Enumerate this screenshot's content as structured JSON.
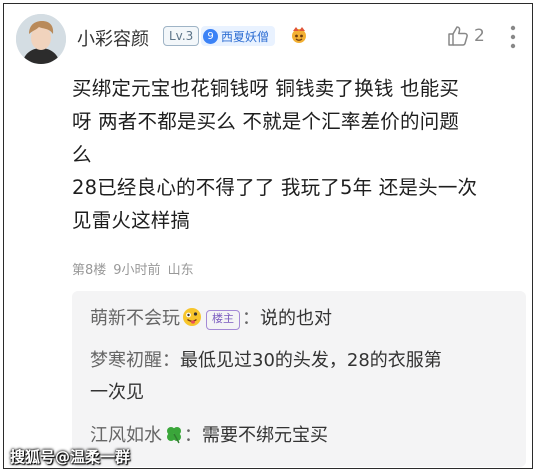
{
  "comment": {
    "username": "小彩容颜",
    "level": "Lv.3",
    "badge_number": "9",
    "badge_text": "西夏妖僧",
    "like_count": "2",
    "text_lines": [
      "买绑定元宝也花铜钱呀 铜钱卖了换钱 也能买",
      "呀 两者不都是买么 不就是个汇率差价的问题",
      "么",
      "28已经良心的不得了了 我玩了5年 还是头一次",
      "见雷火这样搞"
    ],
    "floor": "第8楼",
    "time": "9小时前",
    "location": "山东"
  },
  "replies": [
    {
      "name": "萌新不会玩",
      "op_badge": "楼主",
      "separator": "：",
      "text": "说的也对"
    },
    {
      "name": "梦寒初醒",
      "separator": "：",
      "text_line1": "最低见过30的头发，28的衣服第",
      "text_line2": "一次见"
    },
    {
      "name": "江风如水",
      "separator": "：",
      "text": "需要不绑元宝买"
    }
  ],
  "watermark": "搜狐号@温柔一群",
  "icons": {
    "like": "thumbs-up-icon",
    "more": "vertical-dots-icon",
    "avatar": "user-avatar",
    "extra": "game-icon",
    "emoji": "silly-face-emoji",
    "clover": "four-leaf-clover-icon"
  },
  "colors": {
    "tag_blue": "#3b82f6",
    "op_purple": "#7a5bbf",
    "reply_bg": "#f4f4f5"
  }
}
